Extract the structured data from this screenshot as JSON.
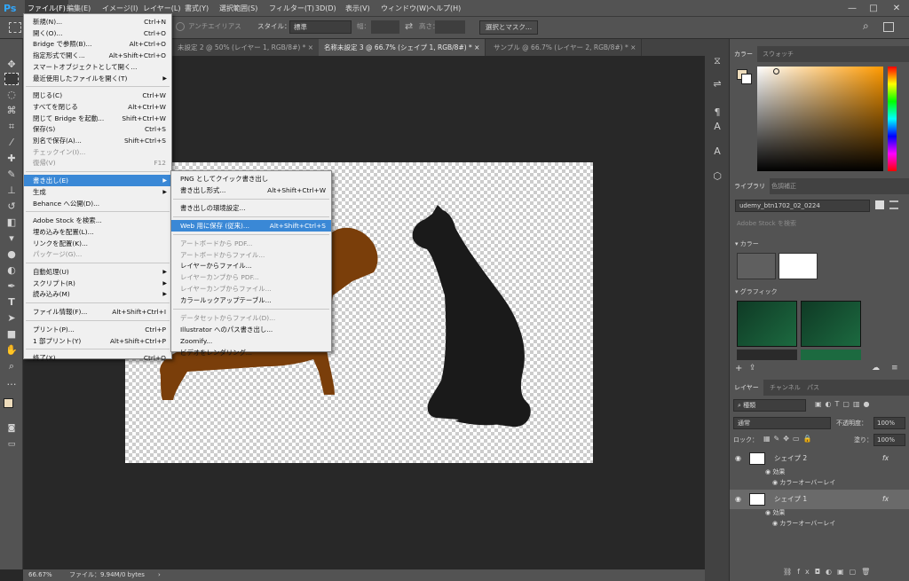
{
  "menubar": {
    "logo": "Ps",
    "items": [
      "ファイル(F)",
      "編集(E)",
      "イメージ(I)",
      "レイヤー(L)",
      "書式(Y)",
      "選択範囲(S)",
      "フィルター(T)",
      "3D(D)",
      "表示(V)",
      "ウィンドウ(W)",
      "ヘルプ(H)"
    ],
    "win_min": "—",
    "win_max": "□",
    "win_close": "✕"
  },
  "options": {
    "antialias": "アンチエイリアス",
    "style_label": "スタイル：",
    "style_value": "標準",
    "width_label": "幅：",
    "height_label": "高さ：",
    "select_mask": "選択とマスク..."
  },
  "tabs": [
    "未設定 2 @ 50% (レイヤー 1, RGB/8#) *  ×",
    "名称未設定 3 @ 66.7% (シェイプ 1, RGB/8#) *  ×",
    "サンプル @ 66.7% (レイヤー 2, RGB/8#) *  ×"
  ],
  "status": {
    "zoom": "66.67%",
    "file": "ファイル：9.94M/0 bytes",
    "arrow": "›"
  },
  "file_menu": [
    {
      "label": "新規(N)...",
      "sc": "Ctrl+N"
    },
    {
      "label": "開く(O)...",
      "sc": "Ctrl+O"
    },
    {
      "label": "Bridge で参照(B)...",
      "sc": "Alt+Ctrl+O"
    },
    {
      "label": "指定形式で開く...",
      "sc": "Alt+Shift+Ctrl+O"
    },
    {
      "label": "スマートオブジェクトとして開く...",
      "sc": ""
    },
    {
      "label": "最近使用したファイルを開く(T)",
      "sc": "",
      "sub": true
    },
    {
      "label": "閉じる(C)",
      "sc": "Ctrl+W"
    },
    {
      "label": "すべてを閉じる",
      "sc": "Alt+Ctrl+W"
    },
    {
      "label": "閉じて Bridge を起動...",
      "sc": "Shift+Ctrl+W"
    },
    {
      "label": "保存(S)",
      "sc": "Ctrl+S"
    },
    {
      "label": "別名で保存(A)...",
      "sc": "Shift+Ctrl+S"
    },
    {
      "label": "チェックイン(I)...",
      "sc": "",
      "dis": true
    },
    {
      "label": "復帰(V)",
      "sc": "F12",
      "dis": true
    },
    {
      "label": "書き出し(E)",
      "sc": "",
      "sub": true,
      "hl": true
    },
    {
      "label": "生成",
      "sc": "",
      "sub": true
    },
    {
      "label": "Behance へ公開(D)...",
      "sc": ""
    },
    {
      "label": "Adobe Stock を検索...",
      "sc": ""
    },
    {
      "label": "埋め込みを配置(L)...",
      "sc": ""
    },
    {
      "label": "リンクを配置(K)...",
      "sc": ""
    },
    {
      "label": "パッケージ(G)...",
      "sc": "",
      "dis": true
    },
    {
      "label": "自動処理(U)",
      "sc": "",
      "sub": true
    },
    {
      "label": "スクリプト(R)",
      "sc": "",
      "sub": true
    },
    {
      "label": "読み込み(M)",
      "sc": "",
      "sub": true
    },
    {
      "label": "ファイル情報(F)...",
      "sc": "Alt+Shift+Ctrl+I"
    },
    {
      "label": "プリント(P)...",
      "sc": "Ctrl+P"
    },
    {
      "label": "1 部プリント(Y)",
      "sc": "Alt+Shift+Ctrl+P"
    },
    {
      "label": "終了(X)",
      "sc": "Ctrl+Q"
    }
  ],
  "export_menu": [
    {
      "label": "PNG としてクイック書き出し",
      "sc": ""
    },
    {
      "label": "書き出し形式...",
      "sc": "Alt+Shift+Ctrl+W"
    },
    {
      "label": "書き出しの環境設定...",
      "sc": ""
    },
    {
      "label": "Web 用に保存 (従来)...",
      "sc": "Alt+Shift+Ctrl+S",
      "hl": true
    },
    {
      "label": "アートボードから PDF...",
      "sc": "",
      "dis": true
    },
    {
      "label": "アートボードからファイル...",
      "sc": "",
      "dis": true
    },
    {
      "label": "レイヤーからファイル...",
      "sc": ""
    },
    {
      "label": "レイヤーカンプから PDF...",
      "sc": "",
      "dis": true
    },
    {
      "label": "レイヤーカンプからファイル...",
      "sc": "",
      "dis": true
    },
    {
      "label": "カラールックアップテーブル...",
      "sc": ""
    },
    {
      "label": "データセットからファイル(D)...",
      "sc": "",
      "dis": true
    },
    {
      "label": "Illustrator へのパス書き出し...",
      "sc": ""
    },
    {
      "label": "Zoomify...",
      "sc": ""
    },
    {
      "label": "ビデオをレンダリング...",
      "sc": ""
    }
  ],
  "color_panel": {
    "tabs": [
      "カラー",
      "スウォッチ"
    ]
  },
  "library_panel": {
    "tabs": [
      "ライブラリ",
      "色調補正"
    ],
    "dropdown": "udemy_btn1702_02_0224",
    "search_placeholder": "Adobe Stock を検索",
    "section_color": "カラー",
    "section_graphic": "グラフィック"
  },
  "layers_panel": {
    "tabs": [
      "レイヤー",
      "チャンネル",
      "パス"
    ],
    "filter": "種類",
    "blend": "通常",
    "opacity_label": "不透明度：",
    "opacity": "100%",
    "lock_label": "ロック：",
    "fill_label": "塗り：",
    "fill": "100%",
    "layers": [
      {
        "name": "シェイプ 2",
        "fx": "fx",
        "effect": "効果",
        "effect_item": "カラーオーバーレイ"
      },
      {
        "name": "シェイプ 1",
        "fx": "fx",
        "effect": "効果",
        "effect_item": "カラーオーバーレイ"
      }
    ]
  },
  "colors": {
    "dog": "#7a3e0a",
    "cat": "#1a1a1a",
    "fg": "#eddcbc",
    "highlight": "#3a88d6"
  }
}
